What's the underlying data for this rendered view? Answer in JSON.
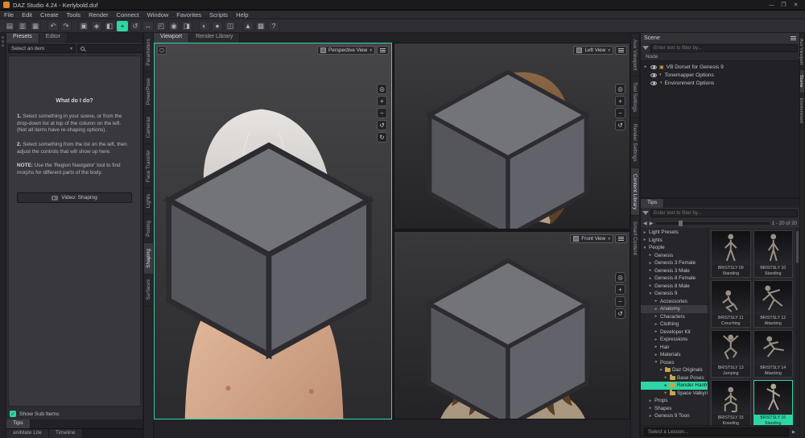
{
  "colors": {
    "accent": "#2fd6a5"
  },
  "icons": {
    "caret": "▾",
    "collapsed": "▸",
    "expanded": "▾",
    "back": "◀",
    "forward": "▶",
    "check": "✓"
  },
  "titlebar": {
    "title": "DAZ Studio 4.24 - Kerlybold.duf",
    "minimize": "—",
    "maximize": "❐",
    "close": "✕"
  },
  "menubar": {
    "items": [
      "File",
      "Edit",
      "Create",
      "Tools",
      "Render",
      "Connect",
      "Window",
      "Favorites",
      "Scripts",
      "Help"
    ]
  },
  "toolbar": {
    "icons": [
      {
        "name": "new-file",
        "glyph": "▤"
      },
      {
        "name": "open-file",
        "glyph": "▥"
      },
      {
        "name": "save-file",
        "glyph": "▦"
      },
      {
        "name": "undo",
        "glyph": "↶"
      },
      {
        "name": "redo",
        "glyph": "↷"
      },
      {
        "name": "scene-info",
        "glyph": "▣"
      },
      {
        "name": "node-selection-tool",
        "glyph": "◈"
      },
      {
        "name": "geometry-editor-tool",
        "glyph": "◧"
      },
      {
        "name": "universal-tool",
        "glyph": "+"
      },
      {
        "name": "rotate-tool",
        "glyph": "↺"
      },
      {
        "name": "translate-tool",
        "glyph": "↔"
      },
      {
        "name": "scale-tool",
        "glyph": "◰"
      },
      {
        "name": "active-pose-tool",
        "glyph": "◉"
      },
      {
        "name": "surface-selection-tool",
        "glyph": "◨"
      },
      {
        "name": "spot-render-tool",
        "glyph": "◐"
      },
      {
        "name": "render",
        "glyph": "●"
      },
      {
        "name": "aux-viewport",
        "glyph": "◫"
      },
      {
        "name": "new-primitive",
        "glyph": "▲"
      },
      {
        "name": "smart-content",
        "glyph": "▩"
      },
      {
        "name": "help",
        "glyph": "?"
      }
    ]
  },
  "left_panel": {
    "tab_presets": "Presets",
    "tab_editor": "Editor",
    "item_selector": "Select an item",
    "help_title": "What do I do?",
    "step1_num": "1.",
    "step1": "Select something in your scene, or from the drop-down list at top of the column on the left. (Not all items have re-shaping options).",
    "step2_num": "2.",
    "step2": "Select something from the list on the left, then adjust the controls that will show up here.",
    "note_label": "NOTE:",
    "note": "Use the 'Region Navigator' tool to find morphs for different parts of the body.",
    "video_button": "Video: Shaping",
    "show_sub_items": "Show Sub Items",
    "tips_tab": "Tips"
  },
  "left_strip": {
    "items": [
      "Parameters",
      "PowerPose",
      "Cameras",
      "Face Transfer",
      "Lights",
      "Posing",
      "Shaping",
      "Surfaces"
    ]
  },
  "viewport": {
    "tab_viewport": "Viewport",
    "tab_render_library": "Render Library",
    "main_label": "Perspective View",
    "left_label": "Left View",
    "front_label": "Front View",
    "nav": [
      "◎",
      "+",
      "−",
      "↺",
      "↻"
    ]
  },
  "right_inner_strip": {
    "items": [
      "Aux Viewport",
      "Tool Settings",
      "Render Settings",
      "Content Library",
      "Smart Content"
    ]
  },
  "right_outer_strip": {
    "items": [
      "Aux Viewport",
      "Scene",
      "Environment"
    ]
  },
  "scene_panel": {
    "title": "Scene",
    "filter_placeholder": "Enter text to filter by...",
    "column_header": "Node",
    "nodes": [
      "VB Dorset for Genesis 9",
      "Tonemapper Options",
      "Environment Options"
    ]
  },
  "content_library": {
    "tips_tab": "Tips",
    "filter_placeholder": "Enter text to filter by...",
    "pagination": "1 - 20 of 20",
    "tree": [
      "Light Presets",
      "Lights",
      "People",
      "Genesis",
      "Genesis 3 Female",
      "Genesis 3 Male",
      "Genesis 8 Female",
      "Genesis 8 Male",
      "Genesis 9",
      "Accessories",
      "Anatomy",
      "Characters",
      "Clothing",
      "Developer Kit",
      "Expressions",
      "Hair",
      "Materials",
      "Poses",
      "Daz Originals",
      "Base Poses",
      "Render Hanfre",
      "Space Valkyrie",
      "Props",
      "Shapes",
      "Genesis 9 Toon"
    ],
    "thumbs": [
      {
        "name": "BRISTSLY 09",
        "pose": "Standing"
      },
      {
        "name": "BRISTSLY 10",
        "pose": "Standing"
      },
      {
        "name": "BRISTSLY 11",
        "pose": "Crouching"
      },
      {
        "name": "BRISTSLY 12",
        "pose": "Attacking"
      },
      {
        "name": "BRISTSLY 13",
        "pose": "Jumping"
      },
      {
        "name": "BRISTSLY 14",
        "pose": "Attacking"
      },
      {
        "name": "BRISTSLY 15",
        "pose": "Kneeling"
      },
      {
        "name": "BRISTSLY 16",
        "pose": "Standing"
      }
    ]
  },
  "bottom": {
    "animate_tab": "aniMate Lite",
    "timeline_tab": "Timeline",
    "lesson": "Select a Lesson..."
  }
}
